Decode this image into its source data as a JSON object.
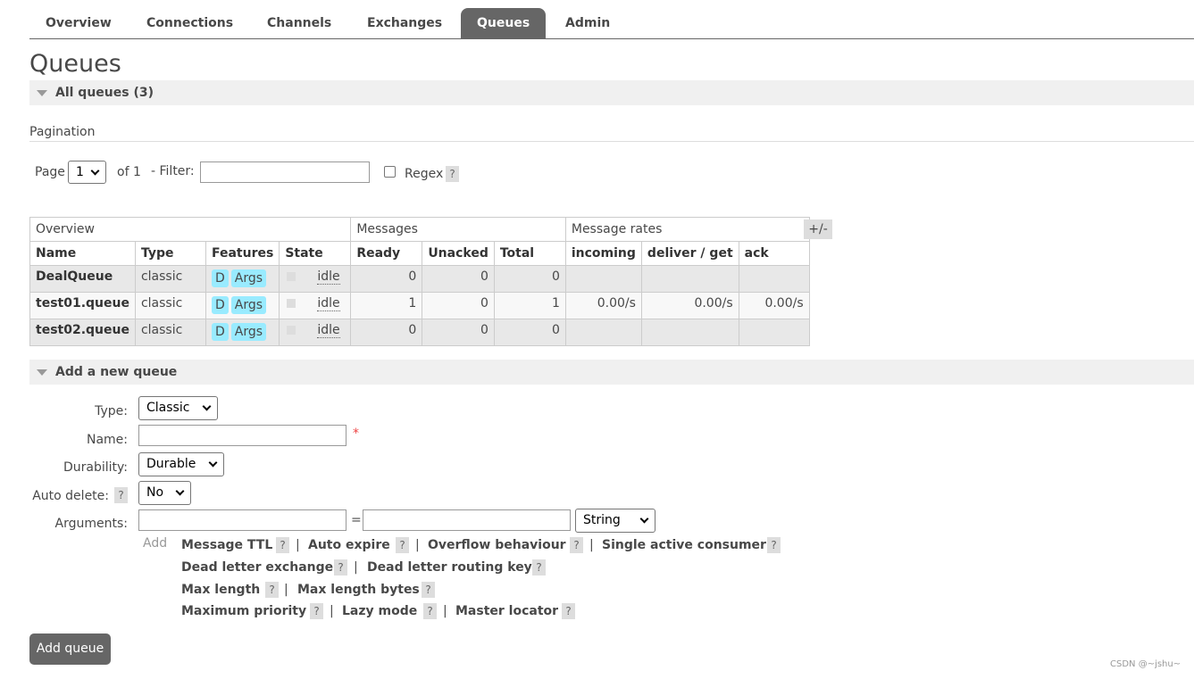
{
  "nav": {
    "tabs": [
      {
        "label": "Overview"
      },
      {
        "label": "Connections"
      },
      {
        "label": "Channels"
      },
      {
        "label": "Exchanges"
      },
      {
        "label": "Queues",
        "active": true
      },
      {
        "label": "Admin"
      }
    ]
  },
  "page": {
    "title": "Queues"
  },
  "all_queues": {
    "label": "All queues (3)"
  },
  "pagination": {
    "title": "Pagination",
    "page_label": "Page",
    "page_value": "1",
    "of_label": "of 1",
    "filter_label": "- Filter:",
    "filter_value": "",
    "regex_label": "Regex",
    "regex_checked": false,
    "help": "?"
  },
  "table": {
    "groups": [
      "Overview",
      "Messages",
      "Message rates"
    ],
    "columns": [
      "Name",
      "Type",
      "Features",
      "State",
      "Ready",
      "Unacked",
      "Total",
      "incoming",
      "deliver / get",
      "ack"
    ],
    "toggle_label": "+/-",
    "rows": [
      {
        "name": "DealQueue",
        "type": "classic",
        "features": [
          "D",
          "Args"
        ],
        "state": "idle",
        "ready": "0",
        "unacked": "0",
        "total": "0",
        "incoming": "",
        "deliver": "",
        "ack": ""
      },
      {
        "name": "test01.queue",
        "type": "classic",
        "features": [
          "D",
          "Args"
        ],
        "state": "idle",
        "ready": "1",
        "unacked": "0",
        "total": "1",
        "incoming": "0.00/s",
        "deliver": "0.00/s",
        "ack": "0.00/s"
      },
      {
        "name": "test02.queue",
        "type": "classic",
        "features": [
          "D",
          "Args"
        ],
        "state": "idle",
        "ready": "0",
        "unacked": "0",
        "total": "0",
        "incoming": "",
        "deliver": "",
        "ack": ""
      }
    ]
  },
  "add_queue": {
    "section_label": "Add a new queue",
    "type_label": "Type:",
    "type_value": "Classic",
    "name_label": "Name:",
    "name_value": "",
    "required_mark": "*",
    "durability_label": "Durability:",
    "durability_value": "Durable",
    "auto_delete_label": "Auto delete:",
    "auto_delete_value": "No",
    "arguments_label": "Arguments:",
    "arg_equals": "=",
    "arg_type_value": "String",
    "add_label": "Add",
    "arg_links": [
      "Message TTL",
      "Auto expire",
      "Overflow behaviour",
      "Single active consumer",
      "Dead letter exchange",
      "Dead letter routing key",
      "Max length",
      "Max length bytes",
      "Maximum priority",
      "Lazy mode",
      "Master locator"
    ],
    "separator": "|",
    "submit_label": "Add queue"
  },
  "watermark": "CSDN @~jshu~",
  "colors": {
    "tab_active_bg": "#666666",
    "feature_badge": "#99ebff",
    "section_bar": "#f0f0f0",
    "required": "#ee4444"
  }
}
